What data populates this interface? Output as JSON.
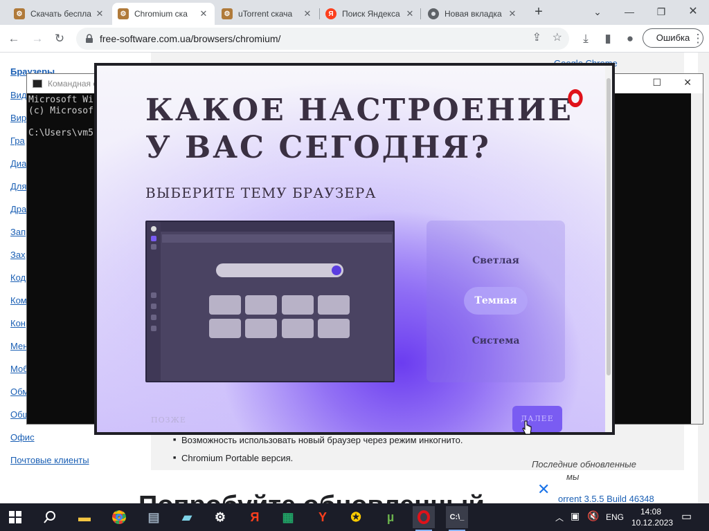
{
  "tabs": [
    {
      "title": "Скачать беспла",
      "favicon": "free-software-icon",
      "active": false
    },
    {
      "title": "Chromium ска",
      "favicon": "free-software-icon",
      "active": true
    },
    {
      "title": "uTorrent скача",
      "favicon": "free-software-icon",
      "active": false
    },
    {
      "title": "Поиск Яндекса",
      "favicon": "yandex-icon",
      "active": false
    },
    {
      "title": "Новая вкладка",
      "favicon": "chrome-icon",
      "active": false
    }
  ],
  "yandex_letter": "Я",
  "toolbar": {
    "url": "free-software.com.ua/browsers/chromium/",
    "profile_error_label": "Ошибка"
  },
  "sidebar": {
    "links": [
      "Браузеры",
      "Вид",
      "Вир",
      "Гра",
      "Диа",
      "Для",
      "Дра",
      "Зап",
      "Зах",
      "Код",
      "Ком",
      "Кон",
      "Мен",
      "Моб",
      "Обм",
      "Общ",
      "Офис",
      "Почтовые клиенты"
    ]
  },
  "content": {
    "bullets": [
      "Возможность использовать новый браузер через режим инкогнито.",
      "Chromium Portable версия."
    ],
    "right_note_1": "Последние обновленные",
    "right_note_2": "мы",
    "big_heading": "Попробуйте обновленный",
    "right_item": "orrent 3.5.5 Build 46348",
    "top_right_link": "Google Chrome"
  },
  "cmd": {
    "title": "Командная с",
    "lines": "Microsoft Wi\n(c) Microsof\n\nC:\\Users\\vm5"
  },
  "installer": {
    "headline_line1": "КАКОЕ  НАСТРОЕНИЕ",
    "headline_line2": "У  ВАС  СЕГОДНЯ?",
    "subhead": "ВЫБЕРИТЕ  ТЕМУ  БРАУЗЕРА",
    "themes": [
      "Светлая",
      "Темная",
      "Система"
    ],
    "selected_theme": "Темная",
    "later_label": "ПОЗЖЕ",
    "next_label": "ДАЛЕЕ",
    "brand_color": "#e0121a",
    "accent_color": "#7a5cf2"
  },
  "taskbar": {
    "apps": [
      "file-explorer-icon",
      "chrome-icon",
      "app-icon",
      "notepad-icon",
      "settings-gear-icon",
      "yandex-icon",
      "excel-icon",
      "yandex-browser-icon",
      "yandex-market-icon",
      "utorrent-icon",
      "opera-icon",
      "cmd-icon"
    ],
    "language": "ENG",
    "time": "14:08",
    "date": "10.12.2023"
  }
}
